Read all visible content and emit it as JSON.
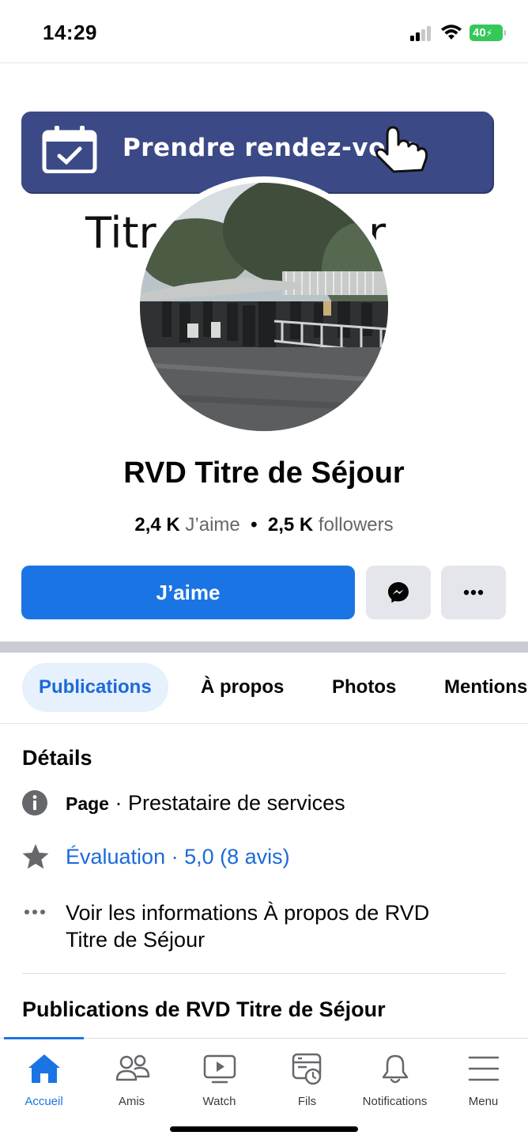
{
  "status_bar": {
    "time": "14:29",
    "battery": "40"
  },
  "cover": {
    "banner_label": "Prendre rendez-vous",
    "text_left": "Titr",
    "text_right": "r"
  },
  "profile": {
    "name": "RVD Titre de Séjour",
    "likes_count": "2,4 K",
    "likes_label": "J’aime",
    "followers_count": "2,5 K",
    "followers_label": "followers",
    "separator": "•"
  },
  "actions": {
    "like_label": "J’aime"
  },
  "tabs": [
    {
      "label": "Publications",
      "active": true
    },
    {
      "label": "À propos",
      "active": false
    },
    {
      "label": "Photos",
      "active": false
    },
    {
      "label": "Mentions",
      "active": false
    }
  ],
  "details": {
    "title": "Détails",
    "category_prefix": "Page",
    "category_text": " · Prestataire de services",
    "rating": "Évaluation · 5,0 (8 avis)",
    "about_line1": "Voir les informations À propos de RVD",
    "about_line2": "Titre de Séjour"
  },
  "posts_title": "Publications de RVD Titre de Séjour",
  "nav": [
    {
      "label": "Accueil",
      "icon": "home-icon",
      "active": true
    },
    {
      "label": "Amis",
      "icon": "friends-icon",
      "active": false
    },
    {
      "label": "Watch",
      "icon": "watch-icon",
      "active": false
    },
    {
      "label": "Fils",
      "icon": "feeds-icon",
      "active": false
    },
    {
      "label": "Notifications",
      "icon": "bell-icon",
      "active": false
    },
    {
      "label": "Menu",
      "icon": "menu-icon",
      "active": false
    }
  ],
  "colors": {
    "accent": "#1b74e4",
    "banner": "#3b4a86",
    "battery": "#34c759"
  }
}
